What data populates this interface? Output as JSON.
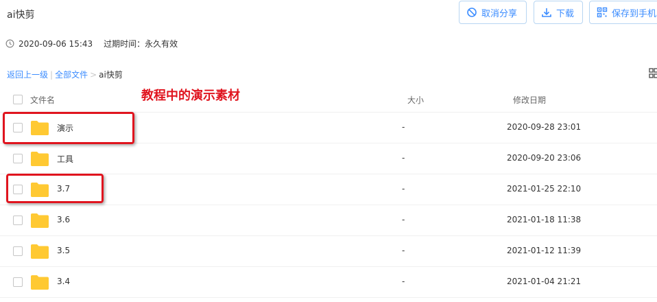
{
  "header": {
    "title": "ai快剪",
    "buttons": {
      "cancel_share": "取消分享",
      "download": "下载",
      "save_to_phone": "保存到手机"
    }
  },
  "meta": {
    "share_time": "2020-09-06 15:43",
    "expire_label": "过期时间：",
    "expire_value": "永久有效"
  },
  "breadcrumb": {
    "back": "返回上一级",
    "separator": "|",
    "all_files": "全部文件",
    "arrow": ">",
    "current": "ai快剪"
  },
  "table": {
    "columns": {
      "name": "文件名",
      "size": "大小",
      "date": "修改日期"
    },
    "rows": [
      {
        "name": "演示",
        "size": "-",
        "date": "2020-09-28 23:01"
      },
      {
        "name": "工具",
        "size": "-",
        "date": "2020-09-20 23:06"
      },
      {
        "name": "3.7",
        "size": "-",
        "date": "2021-01-25 22:10"
      },
      {
        "name": "3.6",
        "size": "-",
        "date": "2021-01-18 11:38"
      },
      {
        "name": "3.5",
        "size": "-",
        "date": "2021-01-12 11:39"
      },
      {
        "name": "3.4",
        "size": "-",
        "date": "2021-01-04 21:21"
      }
    ]
  },
  "annotation": {
    "text": "教程中的演示素材"
  },
  "colors": {
    "accent": "#3b8cff",
    "folder": "#ffc933",
    "highlight": "#e0141e"
  },
  "icons": [
    "ban-icon",
    "download-icon",
    "qrcode-icon",
    "clock-icon",
    "grid-view-icon",
    "folder-icon"
  ]
}
